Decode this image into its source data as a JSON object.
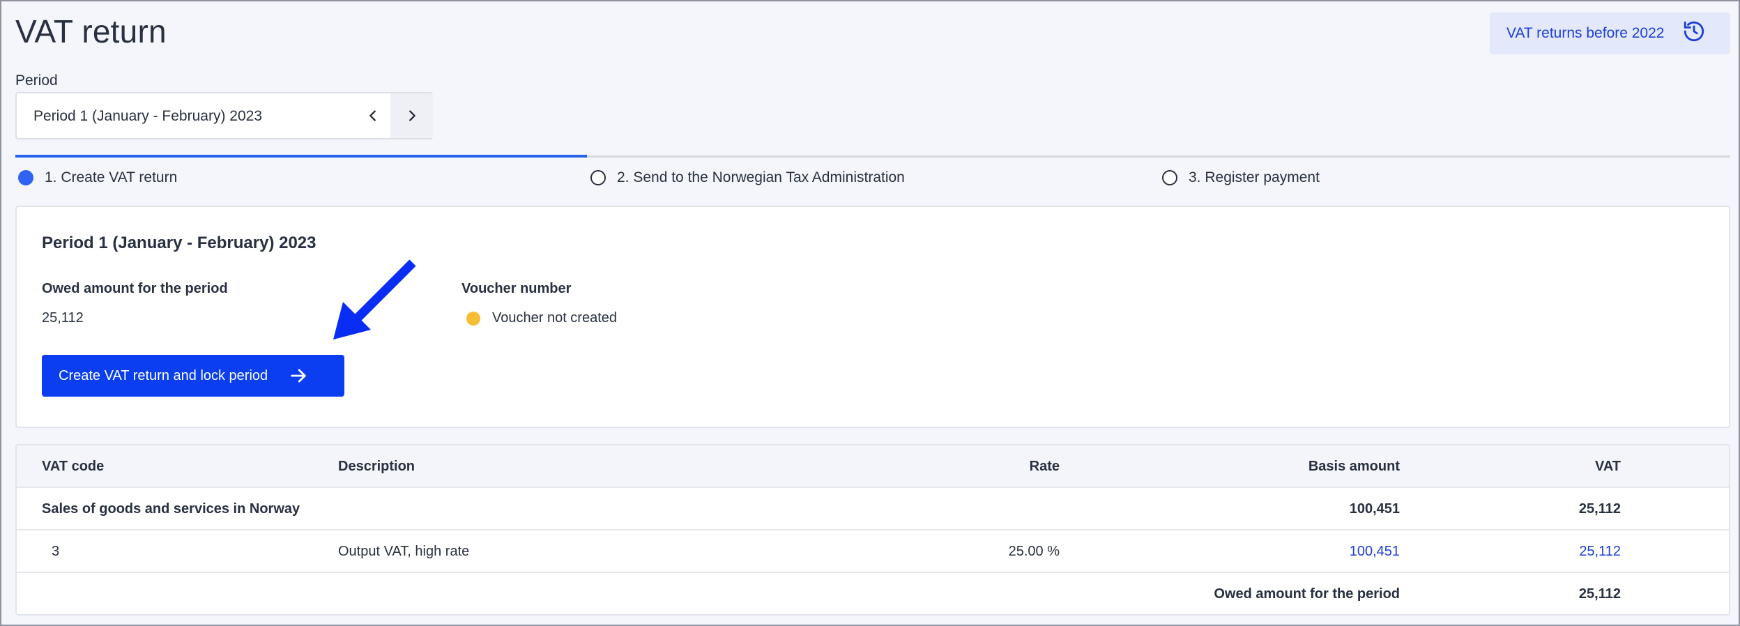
{
  "page": {
    "title": "VAT return",
    "history_button": "VAT returns before 2022"
  },
  "period": {
    "label": "Period",
    "selected": "Period 1 (January - February) 2023"
  },
  "steps": [
    {
      "label": "1. Create VAT return",
      "active": true
    },
    {
      "label": "2. Send to the Norwegian Tax Administration",
      "active": false
    },
    {
      "label": "3. Register payment",
      "active": false
    }
  ],
  "summary": {
    "title": "Period 1 (January - February) 2023",
    "owed_label": "Owed amount for the period",
    "owed_value": "25,112",
    "voucher_label": "Voucher number",
    "voucher_status": "Voucher not created",
    "voucher_status_color": "#f5bd33",
    "primary_button": "Create VAT return and lock period"
  },
  "table": {
    "headers": {
      "vat_code": "VAT code",
      "description": "Description",
      "rate": "Rate",
      "basis": "Basis amount",
      "vat": "VAT"
    },
    "group_row": {
      "label": "Sales of goods and services in Norway",
      "basis": "100,451",
      "vat": "25,112"
    },
    "rows": [
      {
        "code": "3",
        "description": "Output VAT, high rate",
        "rate": "25.00 %",
        "basis": "100,451",
        "vat": "25,112"
      }
    ],
    "total_row": {
      "label": "Owed amount for the period",
      "vat": "25,112"
    }
  },
  "colors": {
    "accent": "#2563eb",
    "primary_button": "#0a3ef0",
    "link": "#1d3fd6",
    "annotation_arrow": "#0a2df5"
  }
}
